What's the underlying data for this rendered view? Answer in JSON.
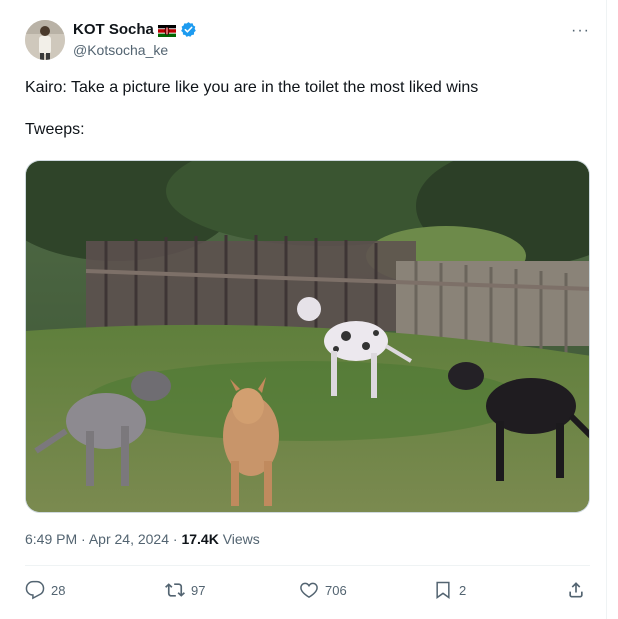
{
  "author": {
    "name": "KOT Socha",
    "handle": "@Kotsocha_ke",
    "avatar_icon": "profile-avatar",
    "flag_icon": "kenya-flag-icon",
    "verified_icon": "verified-badge-icon",
    "verified_color": "#1d9bf0"
  },
  "more_label": "···",
  "text": {
    "line1": "Kairo:  Take a picture like you are in the toilet the most liked wins",
    "line2": "Tweeps:"
  },
  "media": {
    "type": "photo",
    "icon": "photo-of-four-dogs-in-yard"
  },
  "meta": {
    "time": "6:49 PM",
    "separator": "·",
    "date": "Apr 24, 2024",
    "views_count": "17.4K",
    "views_label": "Views"
  },
  "actions": {
    "replies": "28",
    "reposts": "97",
    "likes": "706",
    "bookmarks": "2"
  },
  "colors": {
    "text_primary": "#0f1419",
    "text_secondary": "#536471",
    "border": "#eff3f4"
  }
}
